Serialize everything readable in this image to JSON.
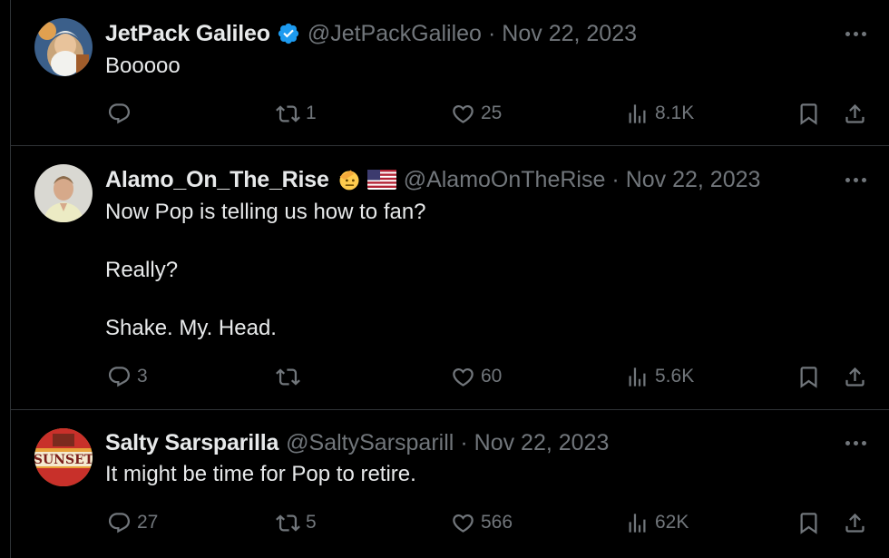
{
  "tweets": [
    {
      "name": "JetPack Galileo",
      "verified": true,
      "handle": "@JetPackGalileo",
      "separator": "·",
      "date": "Nov 22, 2023",
      "text": [
        "Booooo"
      ],
      "replies": "",
      "retweets": "1",
      "likes": "25",
      "views": "8.1K"
    },
    {
      "name": "Alamo_On_The_Rise",
      "verified": false,
      "emoji": [
        "saluting-face",
        "us-flag"
      ],
      "handle": "@AlamoOnTheRise",
      "separator": "·",
      "date": "Nov 22, 2023",
      "text": [
        "Now Pop is telling us how to fan?",
        "Really?",
        "Shake. My. Head."
      ],
      "replies": "3",
      "retweets": "",
      "likes": "60",
      "views": "5.6K"
    },
    {
      "name": "Salty Sarsparilla",
      "verified": false,
      "handle": "@SaltySarsparill",
      "separator": "·",
      "date": "Nov 22, 2023",
      "text": [
        "It might be time for Pop to retire."
      ],
      "avatar_text": "SUNSET",
      "replies": "27",
      "retweets": "5",
      "likes": "566",
      "views": "62K"
    }
  ],
  "colors": {
    "background": "#000000",
    "primary_text": "#e7e9ea",
    "secondary_text": "#71767b",
    "border": "#2f3336",
    "verified": "#1d9bf0"
  }
}
